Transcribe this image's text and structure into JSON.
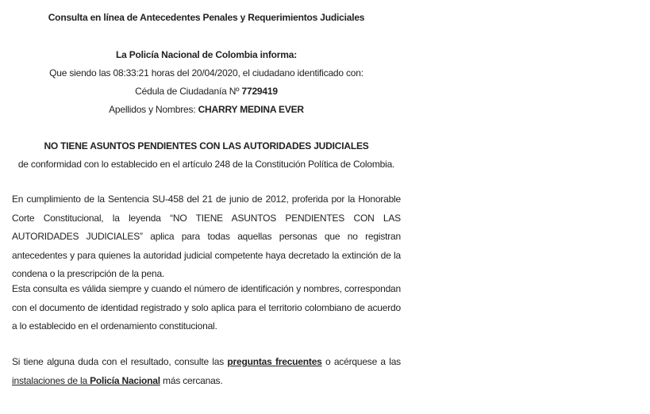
{
  "title": "Consulta en línea de Antecedentes Penales y Requerimientos Judiciales",
  "informa": "La Policía Nacional de Colombia informa:",
  "fecha_line": "Que siendo las 08:33:21 horas del 20/04/2020, el ciudadano identificado con:",
  "cedula_label": "Cédula de Ciudadanía Nº ",
  "cedula_value": "7729419",
  "nombres_label": "Apellidos y Nombres: ",
  "nombres_value": "CHARRY MEDINA EVER",
  "resultado": "NO TIENE ASUNTOS PENDIENTES CON LAS AUTORIDADES JUDICIALES",
  "conformidad": "de conformidad con lo establecido en el artículo 248 de la Constitución Política de Colombia.",
  "parrafo1": "En cumplimiento de la Sentencia SU-458 del 21 de junio de 2012, proferida por la Honorable Corte Constitucional, la leyenda “NO TIENE ASUNTOS PENDIENTES CON LAS AUTORIDADES JUDICIALES” aplica para todas aquellas personas que no registran antecedentes y para quienes la autoridad judicial competente haya decretado la extinción de la condena o la prescripción de la pena.",
  "parrafo2": "Esta consulta es válida siempre y cuando el número de identificación y nombres, correspondan con el documento de identidad registrado y solo aplica para el territorio colombiano de acuerdo a lo establecido en el ordenamiento constitucional.",
  "parrafo3": {
    "before": "Si tiene alguna duda con el resultado, consulte las ",
    "link1": "preguntas frecuentes",
    "middle": " o acérquese a las ",
    "link2_plain": "instalaciones de la ",
    "link2_bold": "Policía Nacional",
    "after": " más cercanas."
  }
}
